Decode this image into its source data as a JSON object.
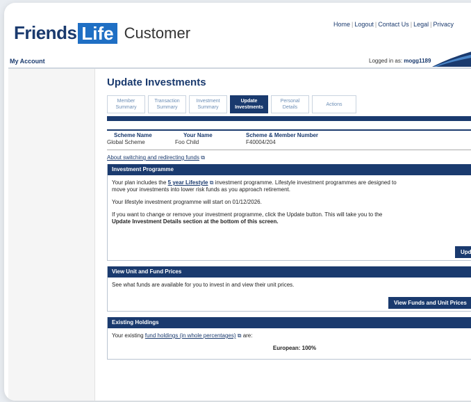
{
  "header": {
    "logo_friends": "Friends",
    "logo_life": "Life",
    "app_title": "Customer",
    "top_links": [
      "Home",
      "Logout",
      "Contact Us",
      "Legal",
      "Privacy"
    ],
    "my_account": "My Account",
    "logged_in_label": "Logged in as:",
    "logged_in_user": "mogg1189"
  },
  "page": {
    "title": "Update Investments",
    "tabs": [
      {
        "line1": "Member",
        "line2": "Summary"
      },
      {
        "line1": "Transaction",
        "line2": "Summary"
      },
      {
        "line1": "Investment",
        "line2": "Summary"
      },
      {
        "line1": "Update",
        "line2": "Investments"
      },
      {
        "line1": "Personal",
        "line2": "Details"
      },
      {
        "line1": "Actions",
        "line2": ""
      }
    ]
  },
  "scheme_table": {
    "headers": [
      "Scheme Name",
      "Your Name",
      "Scheme & Member Number"
    ],
    "values": [
      "Global Scheme",
      "Foo Child",
      "F40004/204"
    ]
  },
  "about_link": "About switching and redirecting funds",
  "investment_programme": {
    "heading": "Investment Programme",
    "para1_prefix": "Your plan includes the",
    "para1_link": "5 year Lifestyle",
    "para1_suffix": "investment programme. Lifestyle investment programmes are designed to",
    "para1_line2": "move your investments into lower risk funds as you approach retirement.",
    "para2": "Your lifestyle investment programme will start on 01/12/2026.",
    "para3_line1": "If you want to change or remove your investment programme, click the Update button. This will take you to the",
    "para3_line2": "Update Investment Details section at the bottom of this screen.",
    "button": "Update"
  },
  "unit_prices": {
    "heading": "View Unit and Fund Prices",
    "text": "See what funds are available for you to invest in and view their unit prices.",
    "button": "View Funds and Unit Prices"
  },
  "holdings": {
    "heading": "Existing Holdings",
    "prefix": "Your existing",
    "link": "fund holdings (in whole percentages)",
    "suffix": "are:",
    "row": "European: 100%"
  }
}
